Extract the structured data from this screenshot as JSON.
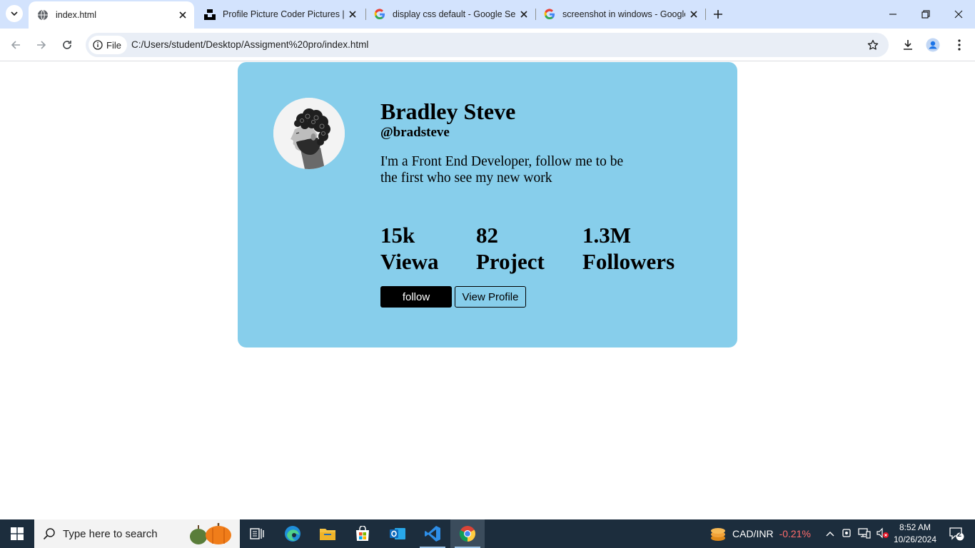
{
  "browser": {
    "tabs": [
      {
        "title": "index.html",
        "active": true,
        "favicon": "globe-icon"
      },
      {
        "title": "Profile Picture Coder Pictures | Unsplash",
        "active": false,
        "favicon": "unsplash-icon"
      },
      {
        "title": "display css default - Google Search",
        "active": false,
        "favicon": "google-icon"
      },
      {
        "title": "screenshot in windows - Google Search",
        "active": false,
        "favicon": "google-icon"
      }
    ],
    "address_chip": "File",
    "url": "C:/Users/student/Desktop/Assigment%20pro/index.html"
  },
  "profile": {
    "name": "Bradley Steve",
    "handle": "@bradsteve",
    "bio": "I'm a Front End Developer, follow me to be the first who see my new work",
    "stats": [
      {
        "value": "15k",
        "label": "Viewa"
      },
      {
        "value": "82",
        "label": "Project"
      },
      {
        "value": "1.3M",
        "label": "Followers"
      }
    ],
    "follow_label": "follow",
    "view_profile_label": "View Profile"
  },
  "taskbar": {
    "search_placeholder": "Type here to search",
    "ticker": {
      "symbol": "CAD/INR",
      "change": "-0.21%"
    },
    "time": "8:52 AM",
    "date": "10/26/2024",
    "notification_count": "2"
  },
  "colors": {
    "card_bg": "#87ceeb",
    "tabstrip_bg": "#d3e3fd",
    "taskbar_bg": "#1c2d3d",
    "ticker_negative": "#ff6b6b"
  }
}
